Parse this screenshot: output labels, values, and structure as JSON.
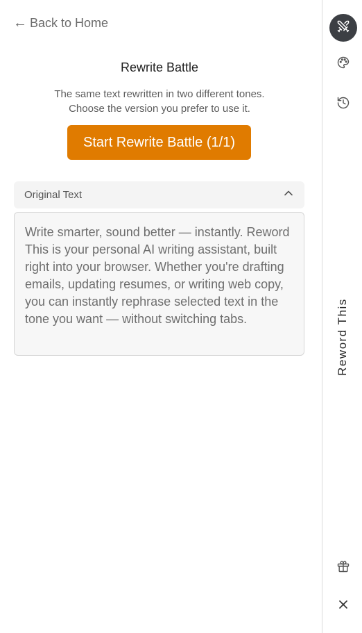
{
  "nav": {
    "back_arrow": "←",
    "back_label": "Back to Home"
  },
  "battle": {
    "title": "Rewrite Battle",
    "subtitle_line1": "The same text rewritten in two different tones.",
    "subtitle_line2": "Choose the version you prefer to use it.",
    "start_button": "Start Rewrite Battle (1/1)"
  },
  "original": {
    "header_label": "Original Text",
    "text": "Write smarter, sound better — instantly. Reword This is your personal AI writing assistant, built right into your browser. Whether you're drafting emails, updating resumes, or writing web copy, you can instantly rephrase selected text in the tone you want — without switching tabs."
  },
  "sidebar": {
    "brand": "Reword This",
    "icons": [
      "swords-icon",
      "palette-icon",
      "history-icon",
      "gift-icon",
      "close-icon"
    ]
  },
  "colors": {
    "accent": "#e07b00",
    "active_icon_bg": "#3c3f44"
  }
}
